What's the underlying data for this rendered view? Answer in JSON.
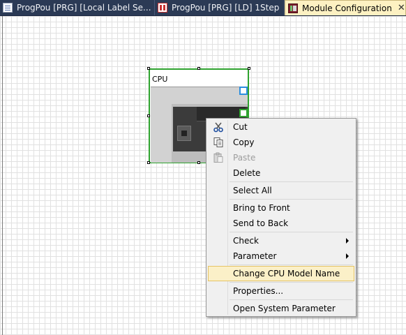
{
  "tabs": [
    {
      "label": "ProgPou [PRG] [Local Label Se...",
      "icon": "label-icon",
      "active": false
    },
    {
      "label": "ProgPou [PRG] [LD] 1Step",
      "icon": "ld-icon",
      "active": false
    },
    {
      "label": "Module Configuration",
      "icon": "module-config-icon",
      "active": true,
      "close": "✕"
    }
  ],
  "module": {
    "title": "CPU"
  },
  "context_menu": {
    "items": [
      {
        "label": "Cut",
        "icon": "scissors-icon",
        "enabled": true
      },
      {
        "label": "Copy",
        "icon": "copy-icon",
        "enabled": true
      },
      {
        "label": "Paste",
        "icon": "paste-icon",
        "enabled": false
      },
      {
        "label": "Delete",
        "enabled": true
      },
      {
        "label": "Select All",
        "enabled": true
      },
      {
        "label": "Bring to Front",
        "enabled": true
      },
      {
        "label": "Send to Back",
        "enabled": true
      },
      {
        "label": "Check",
        "submenu": true,
        "enabled": true
      },
      {
        "label": "Parameter",
        "submenu": true,
        "enabled": true
      },
      {
        "label": "Change CPU Model Name",
        "highlighted": true,
        "enabled": true
      },
      {
        "label": "Properties...",
        "enabled": true
      },
      {
        "label": "Open System Parameter",
        "enabled": true
      }
    ]
  },
  "colors": {
    "tab_bar": "#2b3a55",
    "active_tab": "#fdf1c2",
    "selection": "#2fa32f",
    "highlight": "#fbf0c8"
  }
}
